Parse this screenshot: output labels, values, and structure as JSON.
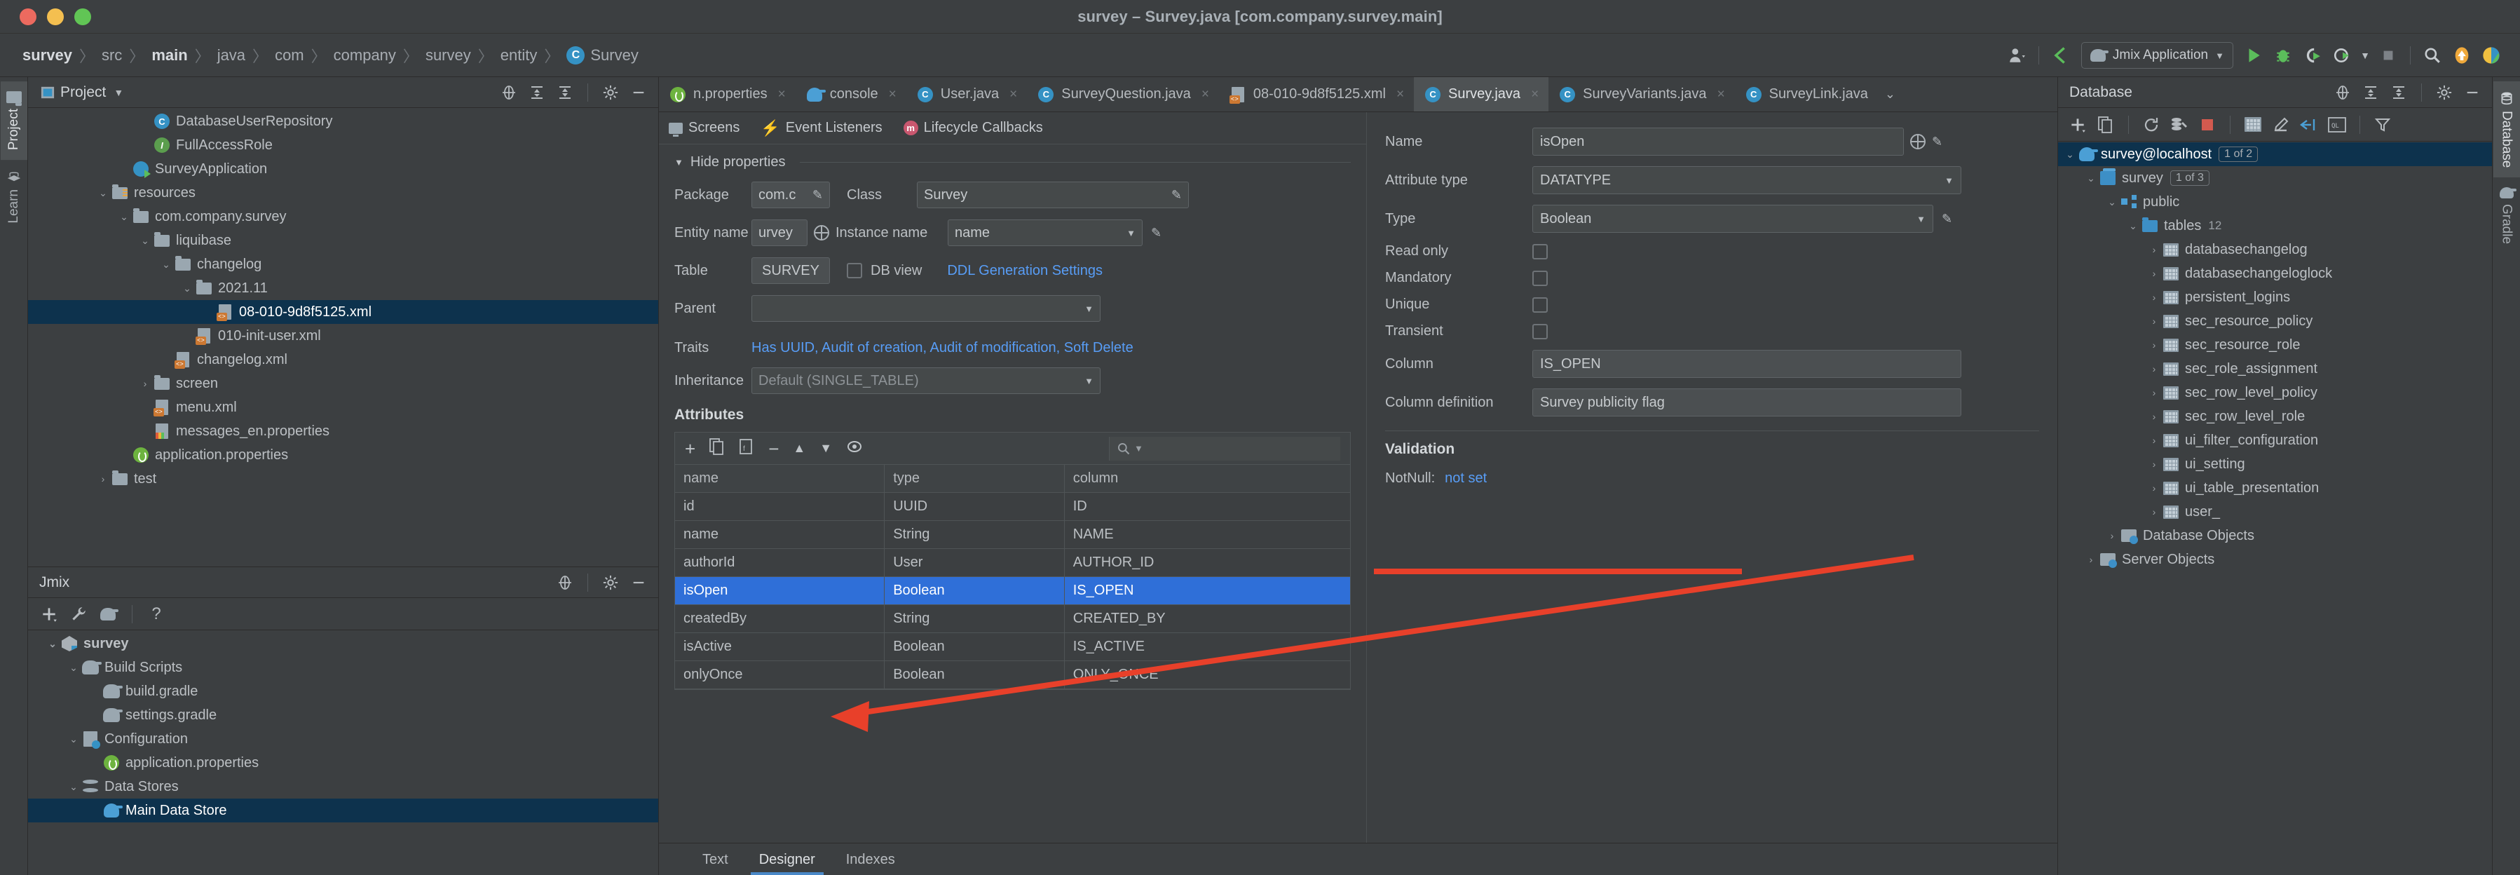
{
  "window": {
    "title": "survey – Survey.java [com.company.survey.main]"
  },
  "breadcrumb": {
    "items": [
      {
        "label": "survey",
        "bold": true
      },
      {
        "label": "src",
        "bold": false
      },
      {
        "label": "main",
        "bold": true
      },
      {
        "label": "java",
        "bold": false
      },
      {
        "label": "com",
        "bold": false
      },
      {
        "label": "company",
        "bold": false
      },
      {
        "label": "survey",
        "bold": false
      },
      {
        "label": "entity",
        "bold": false
      }
    ],
    "file": "Survey",
    "file_badge": "C",
    "separator": "〉"
  },
  "toolbar": {
    "run_config": "Jmix Application",
    "icons": [
      "user-icon",
      "back-arrow-icon",
      "gradle-elephant-icon",
      "run-icon",
      "debug-icon",
      "run-coverage-icon",
      "profiler-icon",
      "stop-icon",
      "search-everywhere-icon",
      "update-icon",
      "jmix-icon"
    ]
  },
  "left_strip": {
    "tabs": [
      {
        "label": "Project",
        "icon": "folder-icon",
        "active": true
      },
      {
        "label": "Learn",
        "icon": "graduation-cap-icon",
        "active": false
      }
    ]
  },
  "right_strip": {
    "tabs": [
      {
        "label": "Database",
        "icon": "database-icon",
        "active": true
      },
      {
        "label": "Gradle",
        "icon": "gradle-elephant-icon",
        "active": false
      }
    ]
  },
  "project_panel": {
    "title": "Project",
    "tree": [
      {
        "indent": 5,
        "label": "DatabaseUserRepository",
        "icon": "class-icon",
        "selected": false,
        "arrow": ""
      },
      {
        "indent": 5,
        "label": "FullAccessRole",
        "icon": "interface-icon",
        "selected": false,
        "arrow": ""
      },
      {
        "indent": 4,
        "label": "SurveyApplication",
        "icon": "spring-run-icon",
        "selected": false,
        "arrow": ""
      },
      {
        "indent": 3,
        "label": "resources",
        "icon": "resources-folder-icon",
        "selected": false,
        "arrow": "⌄"
      },
      {
        "indent": 4,
        "label": "com.company.survey",
        "icon": "folder-icon",
        "selected": false,
        "arrow": "⌄"
      },
      {
        "indent": 5,
        "label": "liquibase",
        "icon": "folder-icon",
        "selected": false,
        "arrow": "⌄"
      },
      {
        "indent": 6,
        "label": "changelog",
        "icon": "folder-icon",
        "selected": false,
        "arrow": "⌄"
      },
      {
        "indent": 7,
        "label": "2021.11",
        "icon": "folder-icon",
        "selected": false,
        "arrow": "⌄"
      },
      {
        "indent": 8,
        "label": "08-010-9d8f5125.xml",
        "icon": "xml-file-icon",
        "selected": true,
        "arrow": ""
      },
      {
        "indent": 7,
        "label": "010-init-user.xml",
        "icon": "xml-file-icon",
        "selected": false,
        "arrow": ""
      },
      {
        "indent": 6,
        "label": "changelog.xml",
        "icon": "xml-file-icon",
        "selected": false,
        "arrow": ""
      },
      {
        "indent": 5,
        "label": "screen",
        "icon": "folder-icon",
        "selected": false,
        "arrow": "›"
      },
      {
        "indent": 5,
        "label": "menu.xml",
        "icon": "xml-file-icon",
        "selected": false,
        "arrow": ""
      },
      {
        "indent": 5,
        "label": "messages_en.properties",
        "icon": "properties-file-icon",
        "selected": false,
        "arrow": ""
      },
      {
        "indent": 4,
        "label": "application.properties",
        "icon": "spring-properties-icon",
        "selected": false,
        "arrow": ""
      },
      {
        "indent": 3,
        "label": "test",
        "icon": "folder-icon",
        "selected": false,
        "arrow": "›"
      }
    ]
  },
  "jmix_panel": {
    "title": "Jmix",
    "tree": [
      {
        "indent": 0,
        "label": "survey",
        "icon": "jmix-icon",
        "selected": false,
        "arrow": "⌄",
        "bold": true
      },
      {
        "indent": 1,
        "label": "Build Scripts",
        "icon": "gradle-elephant-icon",
        "selected": false,
        "arrow": "⌄",
        "bold": false
      },
      {
        "indent": 2,
        "label": "build.gradle",
        "icon": "gradle-elephant-icon",
        "selected": false,
        "arrow": "",
        "bold": false
      },
      {
        "indent": 2,
        "label": "settings.gradle",
        "icon": "gradle-elephant-icon",
        "selected": false,
        "arrow": "",
        "bold": false
      },
      {
        "indent": 1,
        "label": "Configuration",
        "icon": "configuration-icon",
        "selected": false,
        "arrow": "⌄",
        "bold": false
      },
      {
        "indent": 2,
        "label": "application.properties",
        "icon": "spring-properties-icon",
        "selected": false,
        "arrow": "",
        "bold": false
      },
      {
        "indent": 1,
        "label": "Data Stores",
        "icon": "data-store-icon",
        "selected": false,
        "arrow": "⌄",
        "bold": false
      },
      {
        "indent": 2,
        "label": "Main Data Store",
        "icon": "postgres-icon",
        "selected": true,
        "arrow": "",
        "bold": false
      }
    ]
  },
  "editor_tabs": {
    "tabs": [
      {
        "label": "n.properties",
        "icon": "spring-properties-icon",
        "active": false,
        "closable": true
      },
      {
        "label": "console",
        "icon": "postgres-icon",
        "active": false,
        "closable": true
      },
      {
        "label": "User.java",
        "icon": "class-icon",
        "active": false,
        "closable": true
      },
      {
        "label": "SurveyQuestion.java",
        "icon": "class-icon",
        "active": false,
        "closable": true
      },
      {
        "label": "08-010-9d8f5125.xml",
        "icon": "xml-file-icon",
        "active": false,
        "closable": true
      },
      {
        "label": "Survey.java",
        "icon": "class-icon",
        "active": true,
        "closable": true
      },
      {
        "label": "SurveyVariants.java",
        "icon": "class-icon",
        "active": false,
        "closable": true
      },
      {
        "label": "SurveyLink.java",
        "icon": "class-icon",
        "active": false,
        "closable": false
      }
    ],
    "overflow_icon": "chevron-down-icon",
    "close_label": "×"
  },
  "designer": {
    "toolbar": [
      {
        "label": "Screens",
        "icon": "screens-icon"
      },
      {
        "label": "Event Listeners",
        "icon": "bolt-icon"
      },
      {
        "label": "Lifecycle Callbacks",
        "icon": "method-icon"
      }
    ],
    "hide_properties": "Hide properties",
    "fields": {
      "package_label": "Package",
      "package_value": "com.c",
      "class_label": "Class",
      "class_value": "Survey",
      "entity_name_label": "Entity name",
      "entity_name_value": "urvey",
      "instance_name_label": "Instance name",
      "instance_name_value": "name",
      "table_label": "Table",
      "table_value": "SURVEY",
      "db_view_label": "DB view",
      "ddl_link": "DDL Generation Settings",
      "parent_label": "Parent",
      "parent_value": "",
      "traits_label": "Traits",
      "traits_value": "Has UUID, Audit of creation, Audit of modification, Soft Delete",
      "inheritance_label": "Inheritance",
      "inheritance_value": "Default (SINGLE_TABLE)"
    },
    "attributes_section_title": "Attributes",
    "attr_toolbar_icons": [
      "add-icon",
      "copy-icon",
      "generate-icon",
      "remove-icon",
      "move-up-icon",
      "move-down-icon",
      "view-icon"
    ],
    "attr_search_placeholder": "",
    "attributes_table": {
      "columns": [
        "name",
        "type",
        "column"
      ],
      "rows": [
        {
          "name": "id",
          "type": "UUID",
          "column": "ID",
          "selected": false
        },
        {
          "name": "name",
          "type": "String",
          "column": "NAME",
          "selected": false
        },
        {
          "name": "authorId",
          "type": "User",
          "column": "AUTHOR_ID",
          "selected": false
        },
        {
          "name": "isOpen",
          "type": "Boolean",
          "column": "IS_OPEN",
          "selected": true
        },
        {
          "name": "createdBy",
          "type": "String",
          "column": "CREATED_BY",
          "selected": false
        },
        {
          "name": "isActive",
          "type": "Boolean",
          "column": "IS_ACTIVE",
          "selected": false
        },
        {
          "name": "onlyOnce",
          "type": "Boolean",
          "column": "ONLY_ONCE",
          "selected": false
        }
      ]
    },
    "detail": {
      "name_label": "Name",
      "name_value": "isOpen",
      "attribute_type_label": "Attribute type",
      "attribute_type_value": "DATATYPE",
      "type_label": "Type",
      "type_value": "Boolean",
      "read_only_label": "Read only",
      "mandatory_label": "Mandatory",
      "unique_label": "Unique",
      "transient_label": "Transient",
      "column_label": "Column",
      "column_value": "IS_OPEN",
      "column_definition_label": "Column definition",
      "column_definition_value": "Survey publicity flag",
      "validation_title": "Validation",
      "notnull_label": "NotNull:",
      "notnull_value": "not set"
    },
    "bottom_tabs": [
      {
        "label": "Text",
        "active": false
      },
      {
        "label": "Designer",
        "active": true
      },
      {
        "label": "Indexes",
        "active": false
      }
    ]
  },
  "database_panel": {
    "title": "Database",
    "toolbar_icons": [
      "add-icon",
      "copy-icon",
      "refresh-icon",
      "db-tools-icon",
      "stop-icon",
      "table-icon",
      "edit-icon",
      "jump-to-icon",
      "query-console-icon",
      "filter-icon"
    ],
    "tree": [
      {
        "indent": 0,
        "label": "survey@localhost",
        "icon": "postgres-icon",
        "arrow": "⌄",
        "badge": "1 of 2",
        "selected": true,
        "count": ""
      },
      {
        "indent": 1,
        "label": "survey",
        "icon": "stacked-db-icon",
        "arrow": "⌄",
        "badge": "1 of 3",
        "selected": false,
        "count": ""
      },
      {
        "indent": 2,
        "label": "public",
        "icon": "schema-icon",
        "arrow": "⌄",
        "badge": "",
        "selected": false,
        "count": ""
      },
      {
        "indent": 3,
        "label": "tables",
        "icon": "blue-folder-icon",
        "arrow": "⌄",
        "badge": "",
        "selected": false,
        "count": "12"
      },
      {
        "indent": 4,
        "label": "databasechangelog",
        "icon": "db-table-icon",
        "arrow": "›",
        "badge": "",
        "selected": false,
        "count": ""
      },
      {
        "indent": 4,
        "label": "databasechangeloglock",
        "icon": "db-table-icon",
        "arrow": "›",
        "badge": "",
        "selected": false,
        "count": ""
      },
      {
        "indent": 4,
        "label": "persistent_logins",
        "icon": "db-table-icon",
        "arrow": "›",
        "badge": "",
        "selected": false,
        "count": ""
      },
      {
        "indent": 4,
        "label": "sec_resource_policy",
        "icon": "db-table-icon",
        "arrow": "›",
        "badge": "",
        "selected": false,
        "count": ""
      },
      {
        "indent": 4,
        "label": "sec_resource_role",
        "icon": "db-table-icon",
        "arrow": "›",
        "badge": "",
        "selected": false,
        "count": ""
      },
      {
        "indent": 4,
        "label": "sec_role_assignment",
        "icon": "db-table-icon",
        "arrow": "›",
        "badge": "",
        "selected": false,
        "count": ""
      },
      {
        "indent": 4,
        "label": "sec_row_level_policy",
        "icon": "db-table-icon",
        "arrow": "›",
        "badge": "",
        "selected": false,
        "count": ""
      },
      {
        "indent": 4,
        "label": "sec_row_level_role",
        "icon": "db-table-icon",
        "arrow": "›",
        "badge": "",
        "selected": false,
        "count": ""
      },
      {
        "indent": 4,
        "label": "ui_filter_configuration",
        "icon": "db-table-icon",
        "arrow": "›",
        "badge": "",
        "selected": false,
        "count": ""
      },
      {
        "indent": 4,
        "label": "ui_setting",
        "icon": "db-table-icon",
        "arrow": "›",
        "badge": "",
        "selected": false,
        "count": ""
      },
      {
        "indent": 4,
        "label": "ui_table_presentation",
        "icon": "db-table-icon",
        "arrow": "›",
        "badge": "",
        "selected": false,
        "count": ""
      },
      {
        "indent": 4,
        "label": "user_",
        "icon": "db-table-icon",
        "arrow": "›",
        "badge": "",
        "selected": false,
        "count": ""
      },
      {
        "indent": 2,
        "label": "Database Objects",
        "icon": "db-objects-icon",
        "arrow": "›",
        "badge": "",
        "selected": false,
        "count": ""
      },
      {
        "indent": 1,
        "label": "Server Objects",
        "icon": "server-objects-icon",
        "arrow": "›",
        "badge": "",
        "selected": false,
        "count": ""
      }
    ]
  },
  "colors": {
    "accent_blue": "#4a88c7",
    "selection_blue": "#2f6fd8",
    "tree_selection": "#0d324d",
    "link_blue": "#589df6",
    "annotation_red": "#e8402a",
    "background": "#3c3f41"
  }
}
